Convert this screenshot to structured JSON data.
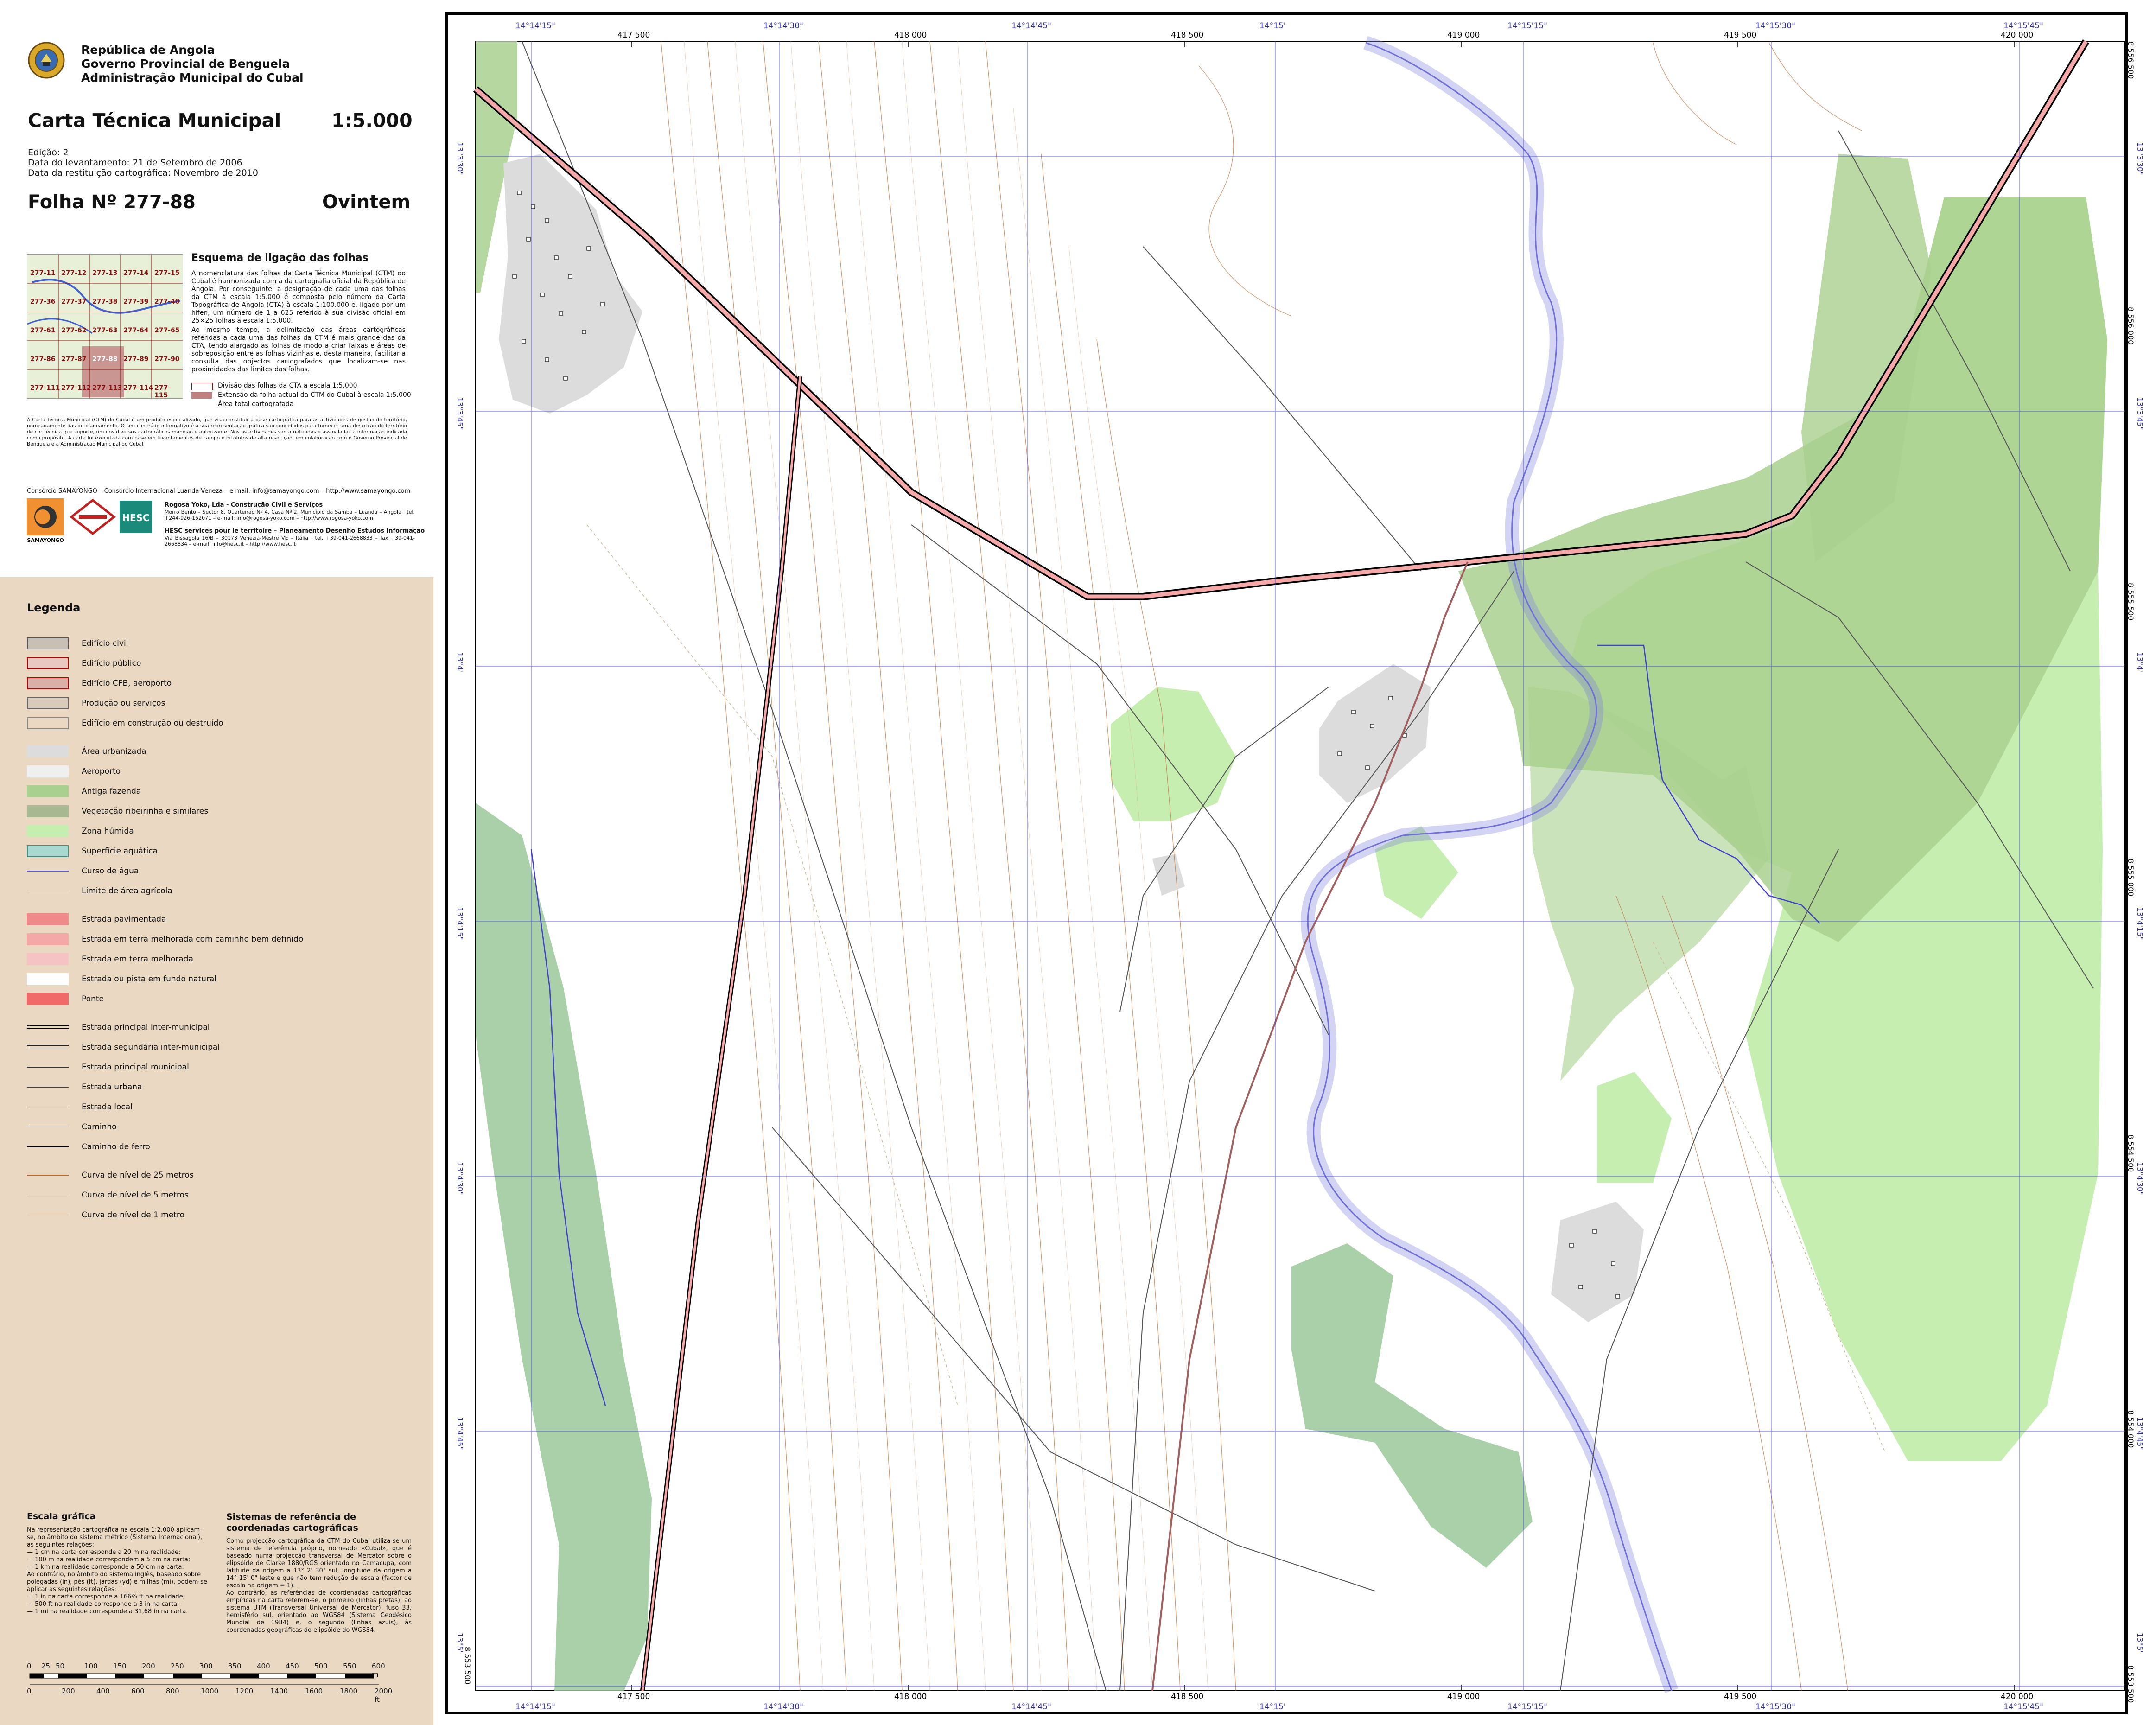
{
  "header": {
    "institution_lines": [
      "República de Angola",
      "Governo Provincial de Benguela",
      "Administração Municipal do Cubal"
    ],
    "title": "Carta Técnica Municipal",
    "scale": "1:5.000",
    "edition": "Edição: 2",
    "survey_date": "Data do levantamento: 21 de Setembro de 2006",
    "restitution_date": "Data da restituição cartográfica: Novembro de 2010",
    "sheet_label": "Folha Nº  277-88",
    "place_name": "Ovintem"
  },
  "sheet_index": {
    "title": "Esquema de ligação das folhas",
    "cells": [
      "277-11",
      "277-12",
      "277-13",
      "277-14",
      "277-15",
      "277-36",
      "277-37",
      "277-38",
      "277-39",
      "277-40",
      "277-61",
      "277-62",
      "277-63",
      "277-64",
      "277-65",
      "277-86",
      "277-87",
      "277-88",
      "277-89",
      "277-90",
      "277-111",
      "277-112",
      "277-113",
      "277-114",
      "277-115"
    ],
    "description": "A nomenclatura das folhas da Carta Técnica Municipal (CTM) do Cubal é harmonizada com a da cartografia oficial da República de Angola. Por conseguinte, a designação de cada uma das folhas da CTM à escala 1:5.000 é composta pelo número da Carta Topográfica de Angola (CTA) à escala 1:100.000 e, ligado por um hífen, um número de 1 a 625 referido à sua divisão oficial em 25×25 folhas à escala 1:5.000.",
    "description2": "Ao mesmo tempo, a delimitação das áreas cartográficas referidas a cada uma das folhas da CTM é mais grande das da CTA, tendo alargado as folhas de modo a criar faixas e áreas de sobreposição entre as folhas vizinhas e, desta maneira, facilitar a consulta das objectos cartografados que localizam-se nas proximidades das limites das folhas.",
    "legend": [
      "Divisão das folhas da CTA à escala 1:5.000",
      "Extensão da folha actual da CTM do Cubal à escala 1:5.000",
      "Área total cartografada"
    ]
  },
  "notes": "A Carta Técnica Municipal (CTM) do Cubal é um produto especializado, que visa constituir a base cartográfica para as actividades de gestão do território, nomeadamente das de planeamento. O seu conteúdo informativo é a sua representação gráfica são concebidos para fornecer uma descrição do território de cor técnica que suporte, um dos diversos cartográficos manejão e autorizante. Nos as actividades são atualizadas e assinaladas a informação indicada como propósito. A carta foi executada com base em levantamentos de campo e ortofotos de alta resolução, em colaboração com o Governo Provincial de Benguela e a Administração Municipal do Cubal.",
  "consortium": {
    "line": "Consórcio SAMAYONGO – Consórcio Internacional Luanda-Veneza – e-mail: info@samayongo.com – http://www.samayongo.com",
    "partner1": "Rogosa Yoko, Lda - Construção Civil e Serviços",
    "partner1_detail": "Morro Bento – Sector 8, Quarteirão Nº 4, Casa Nº 2, Município da Samba – Luanda – Angola · tel. +244-926-152071 – e-mail: info@rogosa-yoko.com – http://www.rogosa-yoko.com",
    "partner2": "HESC services pour le territoire – Planeamento Desenho Estudos Informação",
    "partner2_detail": "Via Bissagola 16/B – 30173 Venezia-Mestre VE – Itália · tel. +39-041-2668833 – fax +39-041-2668834 – e-mail: info@hesc.it – http://www.hesc.it",
    "logo_text": "SAMAYONGO",
    "hesc_logo": "HESC"
  },
  "legend": {
    "title": "Legenda",
    "items": [
      {
        "label": "Edifício civil",
        "kind": "fill",
        "color": "#c8bfb5",
        "border": "#555555"
      },
      {
        "label": "Edifício público",
        "kind": "fill",
        "color": "#e8c8c0",
        "border": "#b00000"
      },
      {
        "label": "Edifício CFB, aeroporto",
        "kind": "fill",
        "color": "#d9b0a8",
        "border": "#b00000"
      },
      {
        "label": "Produção ou serviços",
        "kind": "fill",
        "color": "#d8cbbb",
        "border": "#666666"
      },
      {
        "label": "Edifício em construção ou destruído",
        "kind": "fill",
        "color": "#ead8c3",
        "border": "#888888"
      },
      {
        "label": "Área urbanizada",
        "kind": "fill",
        "color": "#dcdcdc",
        "border": "#dcdcdc"
      },
      {
        "label": "Aeroporto",
        "kind": "fill",
        "color": "#efefef",
        "border": "#efefef"
      },
      {
        "label": "Antiga fazenda",
        "kind": "fill",
        "color": "#a9d08e",
        "border": "#a9d08e"
      },
      {
        "label": "Vegetação ribeirinha e similares",
        "kind": "fill",
        "color": "#a8b890",
        "border": "#a8b890"
      },
      {
        "label": "Zona húmida",
        "kind": "fill",
        "color": "#c6eeb0",
        "border": "#c6eeb0"
      },
      {
        "label": "Superfície aquática",
        "kind": "fill",
        "color": "#a8d8d0",
        "border": "#4a8a80"
      },
      {
        "label": "Curso de água",
        "kind": "line",
        "color": "#5a5ad8",
        "width": 2
      },
      {
        "label": "Limite de área agrícola",
        "kind": "line",
        "color": "#c9b79a",
        "width": 1
      },
      {
        "label": "Estrada pavimentada",
        "kind": "fill",
        "color": "#f08a8a",
        "border": "#f08a8a"
      },
      {
        "label": "Estrada em terra melhorada com caminho bem definido",
        "kind": "fill",
        "color": "#f4a8a8",
        "border": "#f4a8a8"
      },
      {
        "label": "Estrada em terra melhorada",
        "kind": "fill",
        "color": "#f5c3c3",
        "border": "#f5c3c3"
      },
      {
        "label": "Estrada ou pista em fundo natural",
        "kind": "fill",
        "color": "#ffffff",
        "border": "#ffffff"
      },
      {
        "label": "Ponte",
        "kind": "fill",
        "color": "#f06a6a",
        "border": "#f06a6a"
      },
      {
        "label": "Estrada principal inter-municipal",
        "kind": "dline",
        "color": "#000000",
        "width": 3
      },
      {
        "label": "Estrada segundária inter-municipal",
        "kind": "dline",
        "color": "#222222",
        "width": 2
      },
      {
        "label": "Estrada principal municipal",
        "kind": "line",
        "color": "#333333",
        "width": 2
      },
      {
        "label": "Estrada urbana",
        "kind": "line",
        "color": "#444444",
        "width": 2
      },
      {
        "label": "Estrada local",
        "kind": "line",
        "color": "#555555",
        "width": 1.5
      },
      {
        "label": "Caminho",
        "kind": "line",
        "color": "#777777",
        "width": 1
      },
      {
        "label": "Caminho de ferro",
        "kind": "line",
        "color": "#000000",
        "width": 2
      },
      {
        "label": "Curva de nível de 25 metros",
        "kind": "line",
        "color": "#b86a2a",
        "width": 2
      },
      {
        "label": "Curva de nível de 5 metros",
        "kind": "line",
        "color": "#c7905a",
        "width": 1.2
      },
      {
        "label": "Curva de nível de 1 metro",
        "kind": "line",
        "color": "#d9b89a",
        "width": 0.8
      }
    ]
  },
  "escala": {
    "title": "Escala gráfica",
    "text": "Na representação cartográfica na escala 1:2.000 aplicam-se, no âmbito do sistema métrico (Sistema Internacional), as seguintes relações:\n— 1 cm na carta corresponde a 20 m na realidade;\n— 100 m na realidade correspondem a 5 cm na carta;\n— 1 km na realidade corresponde a 50 cm na carta.\nAo contrário, no âmbito do sistema inglês, baseado sobre polegadas (in), pés (ft), jardas (yd) e milhas (mi), podem-se aplicar as seguintes relações:\n— 1 in na carta corresponde a 166⅔ ft na realidade;\n— 500 ft na realidade corresponde a 3 in na carta;\n— 1 mi na realidade corresponde a 31,68 in na carta.",
    "bar_m": [
      "0",
      "25",
      "50",
      "100",
      "150",
      "200",
      "250",
      "300",
      "350",
      "400",
      "450",
      "500",
      "550",
      "600 m"
    ],
    "bar_ft": [
      "0",
      "200",
      "400",
      "600",
      "800",
      "1000",
      "1200",
      "1400",
      "1600",
      "1800",
      "2000 ft"
    ]
  },
  "sistemas": {
    "title": "Sistemas de referência de coordenadas cartográficas",
    "text": "Como projecção cartográfica da CTM do Cubal utiliza-se um sistema de referência próprio, nomeado «Cubal», que é baseado numa projecção transversal de Mercator sobre o elipsóide de Clarke 1880/RGS orientado no Camacupa, com latitude da origem a 13° 2' 30\" sul, longitude da origem a 14° 15' 0\" leste e que não tem redução de escala (factor de escala na origem = 1).\nAo contrário, as referências de coordenadas cartográficas empíricas na carta referem-se, o primeiro (linhas pretas), ao sistema UTM (Transversal Universal de Mercator), fuso 33, hemisfério sul, orientado ao WGS84 (Sistema Geodésico Mundial de 1984) e, o segundo (linhas azuis), às coordenadas geográficas do elipsóide do WGS84."
  },
  "map": {
    "top_easting": [
      "417 500",
      "418 000",
      "418 500",
      "419 000",
      "419 500",
      "420 000"
    ],
    "top_geo": [
      "14°14'15\"",
      "14°14'30\"",
      "14°14'45\"",
      "14°15'",
      "14°15'15\"",
      "14°15'30\"",
      "14°15'45\""
    ],
    "right_northing": [
      "8 556 500",
      "8 556 000",
      "8 555 500",
      "8 555 000",
      "8 554 500",
      "8 554 000",
      "8 553 500"
    ],
    "right_geo": [
      "13°3'30\"",
      "13°3'45\"",
      "13°4'",
      "13°4'15\"",
      "13°4'30\"",
      "13°4'45\"",
      "13°5'"
    ],
    "left_northing": [
      "8 553 500"
    ],
    "left_geo": [
      "13°3'30\"",
      "13°3'45\"",
      "13°4'",
      "13°4'15\"",
      "13°4'30\"",
      "13°4'45\"",
      "13°5'"
    ]
  },
  "colors": {
    "legend_bg": "#ead8c3",
    "road_pink": "#f4a8a8",
    "wetland": "#c6eeb0",
    "farm": "#a9d08e",
    "riparian": "#9bc89a",
    "river_fill": "#d8d8f8",
    "river_edge": "#8080e0",
    "contour": "#c08050",
    "utm_grid": "#000000",
    "geo_grid": "#4040d0"
  }
}
